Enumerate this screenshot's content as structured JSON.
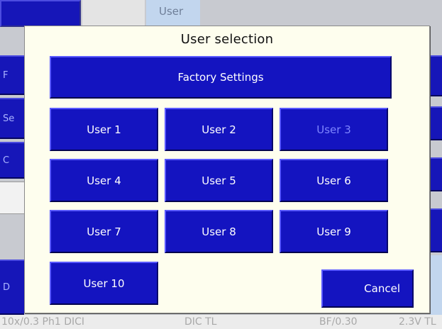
{
  "background": {
    "tabs": [
      {
        "label": ""
      },
      {
        "label": ""
      },
      {
        "label": "User"
      }
    ],
    "left_buttons": [
      "F",
      "Se",
      "C",
      "D"
    ],
    "status_bar": {
      "objective": "10x/0.3 Ph1 DICI",
      "contrast": "DIC TL",
      "filter": "BF/0.30",
      "voltage": "2.3V TL"
    }
  },
  "dialog": {
    "title": "User selection",
    "factory_label": "Factory Settings",
    "users": [
      {
        "label": "User 1",
        "enabled": true
      },
      {
        "label": "User 2",
        "enabled": true
      },
      {
        "label": "User 3",
        "enabled": false
      },
      {
        "label": "User 4",
        "enabled": true
      },
      {
        "label": "User 5",
        "enabled": true
      },
      {
        "label": "User 6",
        "enabled": true
      },
      {
        "label": "User 7",
        "enabled": true
      },
      {
        "label": "User 8",
        "enabled": true
      },
      {
        "label": "User 9",
        "enabled": true
      },
      {
        "label": "User 10",
        "enabled": true
      }
    ],
    "cancel_label": "Cancel"
  },
  "colors": {
    "button_blue": "#1414c0",
    "dialog_bg": "#fefeee",
    "disabled_text": "#7f86ff"
  }
}
